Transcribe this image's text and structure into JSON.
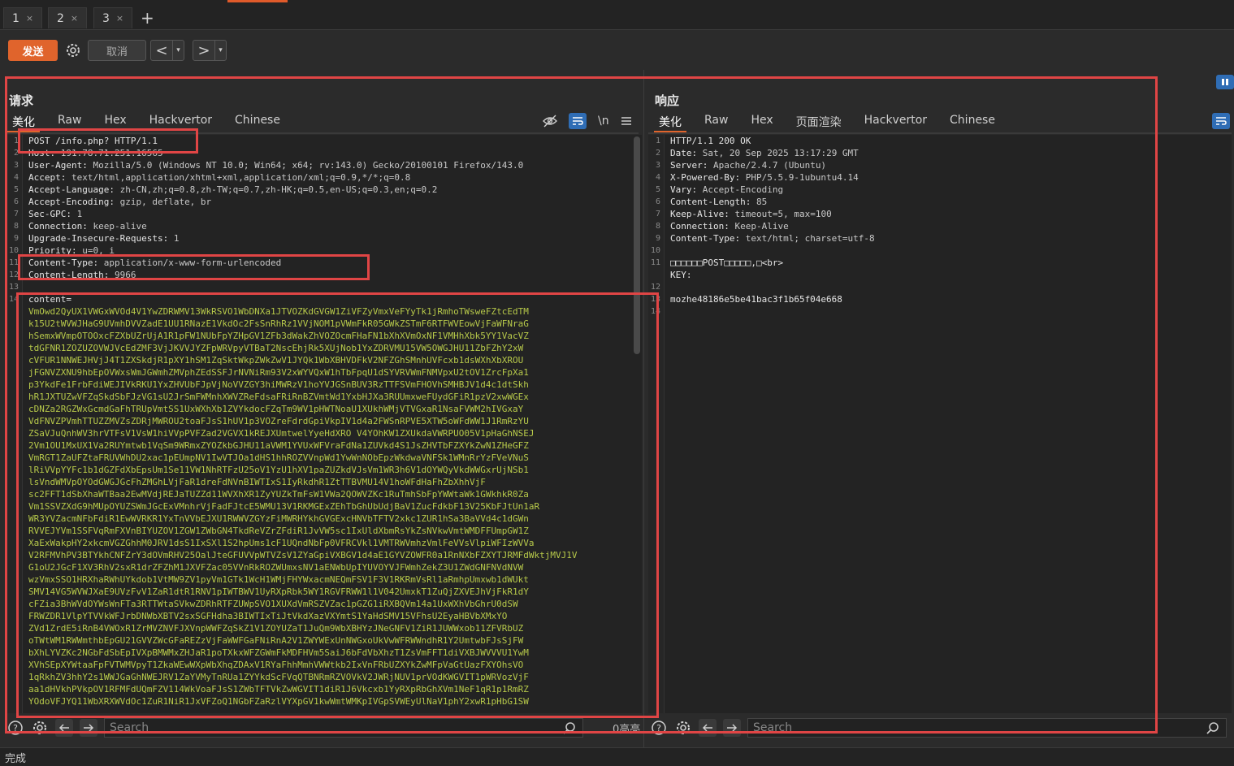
{
  "tabs": [
    {
      "label": "1",
      "close": "×"
    },
    {
      "label": "2",
      "close": "×"
    },
    {
      "label": "3",
      "close": "×"
    }
  ],
  "new_tab": "+",
  "toolbar": {
    "send": "发送",
    "cancel": "取消",
    "back": "<",
    "forward": ">",
    "dropdown": "▾"
  },
  "request": {
    "title": "请求",
    "tabs": [
      "美化",
      "Raw",
      "Hex",
      "Hackvertor",
      "Chinese"
    ],
    "newline_toggle": "\\n",
    "lines": [
      {
        "n": "1",
        "k": "POST /info.php? HTTP/1.1",
        "v": ""
      },
      {
        "n": "2",
        "k": "Host: ",
        "v": "191.78.71.251:16565"
      },
      {
        "n": "3",
        "k": "User-Agent: ",
        "v": "Mozilla/5.0 (Windows NT 10.0; Win64; x64; rv:143.0) Gecko/20100101 Firefox/143.0"
      },
      {
        "n": "4",
        "k": "Accept: ",
        "v": "text/html,application/xhtml+xml,application/xml;q=0.9,*/*;q=0.8"
      },
      {
        "n": "5",
        "k": "Accept-Language: ",
        "v": "zh-CN,zh;q=0.8,zh-TW;q=0.7,zh-HK;q=0.5,en-US;q=0.3,en;q=0.2"
      },
      {
        "n": "6",
        "k": "Accept-Encoding: ",
        "v": "gzip, deflate, br"
      },
      {
        "n": "7",
        "k": "Sec-GPC: ",
        "v": "1"
      },
      {
        "n": "8",
        "k": "Connection: ",
        "v": "keep-alive"
      },
      {
        "n": "9",
        "k": "Upgrade-Insecure-Requests: ",
        "v": "1"
      },
      {
        "n": "10",
        "k": "Priority: ",
        "v": "u=0, i"
      },
      {
        "n": "11",
        "k": "Content-Type: ",
        "v": "application/x-www-form-urlencoded"
      },
      {
        "n": "12",
        "k": "Content-Length: ",
        "v": "9966"
      },
      {
        "n": "13",
        "k": "",
        "v": ""
      },
      {
        "n": "14",
        "k": "content=",
        "v": ""
      }
    ],
    "body_lines": [
      "VmOwd2QyUX1VWGxWVOd4V1YwZDRWMV13WkRSVO1WbDNXa1JTVOZKdGVGW1ZiVFZyVmxVeFYyTk1jRmhoTWsweFZtcEdTM",
      "k15U2tWVWJHaG9UVmhDVVZadE1UU1RNazE1VkdOc2FsSnRhRz1VVjNOM1pVWmFkR05GWkZSTmF6RTFWVEowVjFaWFNraG",
      "hSemxWVmpOTOOxcFZXbUZrUjA1R1pFW1NUbFpYZHpGV1ZFb3dWakZhVOZOcmFHaFN1bXhXVmOxNF1VMHhXbk5YY1VacVZ",
      "tdGFNR1ZOZUZOVWJVcEdZMF3VjJKVVJYZFpWRVpyVTBaT2NscEhjRk5XUjNob1YxZDRVMU15VW5OWGJHU11ZbFZhY2xW",
      "cVFUR1NNWEJHVjJ4T1ZXSkdjR1pXY1hSM1ZqSktWkpZWkZwV1JYQk1WbXBHVDFkV2NFZGhSMnhUVFcxb1dsWXhXbXROU",
      "jFGNVZXNU9hbEpOVWxsWmJGWmhZMVphZEdSSFJrNVNiRm93V2xWYVQxW1hTbFpqU1dSYVRVWmFNMVpxU2tOV1ZrcFpXa1",
      "p3YkdFe1FrbFdiWEJIVkRKU1YxZHVUbFJpVjNoVVZGY3hiMWRzV1hoYVJGSnBUV3RzTTFSVmFHOVhSMHBJV1d4c1dtSkh",
      "hR1JXTUZwVFZqSkdSbFJzVG1sU2JrSmFWMnhXWVZReFdsaFRiRnBZVmtWd1YxbHJXa3RUUmxweFUydGFiR1pzV2xwWGEx",
      "cDNZa2RGZWxGcmdGaFhTRUpVmtSS1UxWXhXb1ZVYkdocFZqTm9WV1pHWTNoaU1XUkhWMjVTVGxaR1NsaFVWM2hIVGxaY",
      "VdFNVZPVmhTTUZZMVZsZDRjMWROU2toaFJsS1hUV1p3VOZreFdrdGpiVkpIV1d4a2FWSnRPVE5XTW5oWFdWW1J1RmRzYU",
      "ZSaVJuQnhWV3hrVTFsV1VsW1hiVVpPVFZad2VGVX1kREJXUmtwelYyeHdXRO V4YOhKW1ZXUkdaVWRPUO05V1pHaGhNSEJ",
      "2Vm1OU1MxUX1Va2RUYmtwb1VqSm9WRmxZYOZkbGJHU11aVWM1YVUxWFVraFdNa1ZUVkd4S1JsZHVTbFZXYkZwN1ZHeGFZ",
      "VmRGT1ZaUFZtaFRUVWhDU2xac1pEUmpNV1IwVTJOa1dHS1hhROZVVnpWd1YwWnNObEpzWkdwaVNFSk1WMnRrYzFVeVNuS",
      "lRiVVpYYFc1b1dGZFdXbEpsUm1Se11VW1NhRTFzU25oV1YzU1hXV1paZUZkdVJsVm1WR3h6V1dOYWQyVkdWWGxrUjNSb1",
      "lsVndWMVpOYOdGWGJGcFhZMGhLVjFaR1dreFdNVnBIWTIxS1IyRkdhR1ZtTTBVMU14V1hoWFdHaFhZbXhhVjF",
      "sc2FFT1dSbXhaWTBaa2EwMVdjREJaTUZZd11WVXhXR1ZyYUZkTmFsW1VWa2QOWVZKc1RuTmhSbFpYWWtaWk1GWkhkR0Za",
      "Vm1SSVZXdG9hMUpOYUZSWmJGcExVMnhrVjFadFJtcE5WMU13V1RKMGExZEhTbGhUbUdjBaV1ZucFdkbF13V25KbFJtUn1aR",
      "WR3YVZacmNFbFdiR1EwWVRKR1YxTnVVbEJXU1RWWVZGYzFiMWRHYkhGVGExcHNVbTFTV2xkc1ZUR1hSa3BaVVd4c1dGWn",
      "RVVEJYVm1SSFVqRmFXVnBIYUZOV1ZGW1ZWbGN4TkdReVZrZFdiR1JvVW5sc1IxUldXbmRsYkZsNVkwVmtWMDFFUmpGW1Z",
      "XaExWakpHY2xkcmVGZGhhM0JRV1dsS1IxSXl1S2hpUms1cF1UQndNbFp0VFRCVkl1VMTRWVmhzVmlFeVVsVlpiWFIzWVVa",
      "V2RFMVhPV3BTYkhCNFZrY3dOVmRHV25OalJteGFUVVpWTVZsV1ZYaGpiVXBGV1d4aE1GYVZOWFR0a1RnNXbFZXYTJRMFdWktjMVJ1V",
      "G1oU2JGcF1XV3RhV2sxR1drZFZhM1JXVFZac05VVnRkROZWUmxsNV1aENWbUpIYUVOYVJFWmhZekZ3U1ZWdGNFNVdNVW",
      "wzVmxSSO1HRXhaRWhUYkdob1VtMW9ZV1pyVm1GTk1WcH1WMjFHYWxacmNEQmFSV1F3V1RKRmVsRl1aRmhpUmxwb1dWUkt",
      "SMV14VG5WVWJXaE9UVzFvV1ZaR1dtR1RNV1pIWTBWV1UyRXpRbk5WY1RGVFRWW1l1V042UmxkT1ZuQjZXVEJhVjFkR1dY",
      "cFZia3BhWVdOYWsWnFTa3RTTWtaSVkwZDRhRTFZUWpSVO1XUXdVmRSZVZac1pGZG1iRXBQVm14a1UxWXhVbGhrU0dSW",
      "FRWZDR1VlpYTVVkWFJrbDNWbXBTV2sxSGFHdha3BIWTIxTiJtVkdXazVXYmtS1YaHdSMV15VFhsU2EyaHBVbXMxYO",
      "ZVd1ZrdE5iRnB4VWOxR1ZrMVZNVFJXVnpWWFZqSkZ1V1ZOYUZaT1JuQm9WbXBHYzJNeGNFV1ZiR1JUWWxob11ZFVRbUZ",
      "oTWtWM1RWWmthbEpGU21GVVZWcGFaREZzVjFaWWFGaFNiRnA2V1ZWYWExUnNWGxoUkVwWFRWWndhR1Y2UmtwbFJsSjFW",
      "bXhLYVZKc2NGbFdSbEpIVXpBMWMxZHJaR1poTXkxWFZGWmFkMDFHVm5SaiJ6bFdVbXhzT1ZsVmFFT1diVXBJWVVVU1YwM",
      "XVhSEpXYWtaaFpFVTWMVpyT1ZkaWEwWXpWbXhqZDAxV1RYaFhhMmhVWWtkb2IxVnFRbUZXYkZwMFpVaGtUazFXYOhsVO",
      "1qRkhZV3hhY2s1WWJGaGhNWEJRV1ZaYVMyTnRUa1ZYYkdScFVqQTBNRmRZVOVkV2JWRjNUV1prVOdKWGVIT1pWRVozVjF",
      "aa1dHVkhPVkpOV1RFMFdUQmFZV114WkVoaFJsS1ZWbTFTVkZwWGVIT1diR1J6Vkcxb1YyRXpRbGhXVm1NeF1qR1p1RmRZ",
      "YOdoVFJYQ11WbXRXWVdOc1ZuR1NiR1JxVFZoQ1NGbFZaRzlVYXpGV1kwWmtWMKpIVGpSVWEyUlNaV1phY2xwR1pHbG1SW"
    ],
    "search_placeholder": "Search",
    "highlight_count": "0高亮"
  },
  "response": {
    "title": "响应",
    "tabs": [
      "美化",
      "Raw",
      "Hex",
      "页面渲染",
      "Hackvertor",
      "Chinese"
    ],
    "lines": [
      {
        "n": "1",
        "k": "HTTP/1.1 200 OK",
        "v": ""
      },
      {
        "n": "2",
        "k": "Date: ",
        "v": "Sat, 20 Sep 2025 13:17:29 GMT"
      },
      {
        "n": "3",
        "k": "Server: ",
        "v": "Apache/2.4.7 (Ubuntu)"
      },
      {
        "n": "4",
        "k": "X-Powered-By: ",
        "v": "PHP/5.5.9-1ubuntu4.14"
      },
      {
        "n": "5",
        "k": "Vary: ",
        "v": "Accept-Encoding"
      },
      {
        "n": "6",
        "k": "Content-Length: ",
        "v": "85"
      },
      {
        "n": "7",
        "k": "Keep-Alive: ",
        "v": "timeout=5, max=100"
      },
      {
        "n": "8",
        "k": "Connection: ",
        "v": "Keep-Alive"
      },
      {
        "n": "9",
        "k": "Content-Type: ",
        "v": "text/html; charset=utf-8"
      },
      {
        "n": "10",
        "k": "",
        "v": ""
      },
      {
        "n": "11",
        "k": "□□□□□□POST□□□□□,□<br>",
        "v": ""
      },
      {
        "n": "",
        "k": "KEY:",
        "v": ""
      },
      {
        "n": "12",
        "k": "",
        "v": ""
      },
      {
        "n": "13",
        "k": "mozhe48186e5be41bac3f1b65f04e668",
        "v": ""
      },
      {
        "n": "14",
        "k": "",
        "v": ""
      }
    ],
    "search_placeholder": "Search"
  },
  "status": "完成",
  "colors": {
    "accent": "#e0642c",
    "annotation": "#e04545",
    "blue_toggle": "#2f6db5"
  }
}
